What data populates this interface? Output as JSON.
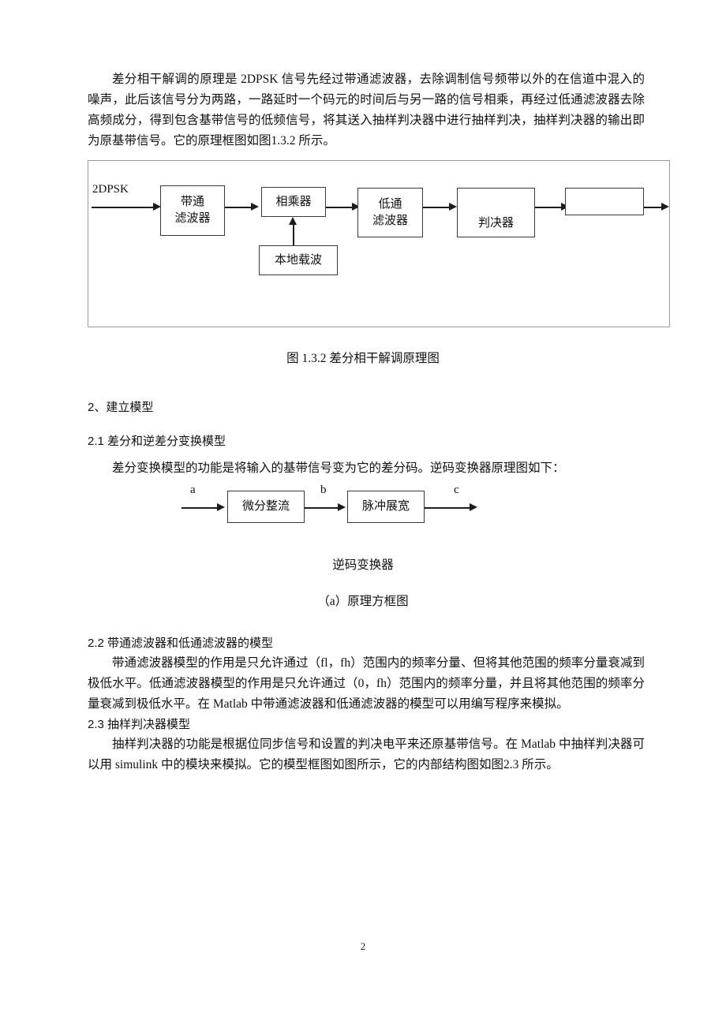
{
  "document": {
    "page_number": "2"
  },
  "paragraphs": {
    "intro": "差分相干解调的原理是 2DPSK 信号先经过带通滤波器，去除调制信号频带以外的在信道中混入的噪声，此后该信号分为两路，一路延时一个码元的时间后与另一路的信号相乘，再经过低通滤波器去除高频成分，得到包含基带信号的低频信号，将其送入抽样判决器中进行抽样判决，抽样判决器的输出即为原基带信号。它的原理框图如图1.3.2 所示。",
    "sec21_body": "差分变换模型的功能是将输入的基带信号变为它的差分码。逆码变换器原理图如下：",
    "sec22_body": "带通滤波器模型的作用是只允许通过（fl，fh）范围内的频率分量、但将其他范围的频率分量衰减到极低水平。低通滤波器模型的作用是只允许通过（0，fh）范围内的频率分量，并且将其他范围的频率分量衰减到极低水平。在 Matlab 中带通滤波器和低通滤波器的模型可以用编写程序来模拟。",
    "sec23_body": "抽样判决器的功能是根据位同步信号和设置的判决电平来还原基带信号。在 Matlab 中抽样判决器可以用 simulink 中的模块来模拟。它的模型框图如图所示，它的内部结构图如图2.3 所示。"
  },
  "headings": {
    "sec2": "2、建立模型",
    "sec21": "2.1 差分和逆差分变换模型",
    "sec22": "2.2 带通滤波器和低通滤波器的模型",
    "sec23": "2.3 抽样判决器模型"
  },
  "figure1": {
    "caption": "图 1.3.2   差分相干解调原理图",
    "input_label": "2DPSK",
    "blocks": [
      {
        "id": "bandpass",
        "line1": "带通",
        "line2": "滤波器"
      },
      {
        "id": "multiplier",
        "line1": "相乘器",
        "line2": ""
      },
      {
        "id": "lowpass",
        "line1": "低通",
        "line2": "滤波器"
      },
      {
        "id": "decision",
        "line1": "判决器",
        "line2": ""
      },
      {
        "id": "output",
        "line1": "",
        "line2": ""
      }
    ],
    "carrier_block": "本地载波"
  },
  "figure2": {
    "blocks": [
      {
        "id": "differentiate-rectify",
        "label": "微分整流"
      },
      {
        "id": "pulse-widen",
        "label": "脉冲展宽"
      }
    ],
    "signal_labels": [
      "a",
      "b",
      "c"
    ],
    "title": "逆码变换器",
    "subcaption": "（a）原理方框图"
  }
}
